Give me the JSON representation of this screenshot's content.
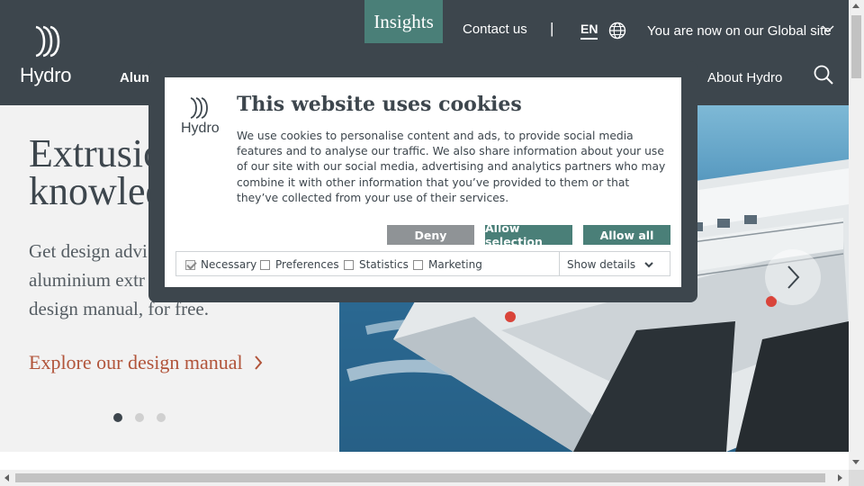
{
  "header": {
    "logo_text": "Hydro",
    "insights": "Insights",
    "contact": "Contact us",
    "separator": "|",
    "language": "EN",
    "site_switch": "You are now on our Global site",
    "nav_aluminium": "Alum",
    "nav_about": "About Hydro"
  },
  "hero": {
    "title": "Extrusio\nknowled",
    "text": "Get design advi\naluminium extr\ndesign manual, for free.",
    "link": "Explore our design manual",
    "slides": 3,
    "active_slide": 1
  },
  "cookie": {
    "logo_text": "Hydro",
    "title": "This website uses cookies",
    "text": "We use cookies to personalise content and ads, to provide social media features and to analyse our traffic. We also share information about your use of our site with our social media, advertising and analytics partners who may combine it with other information that you’ve provided to them or that they’ve collected from your use of their services.",
    "deny": "Deny",
    "allow_selection": "Allow selection",
    "allow_all": "Allow all",
    "options": {
      "necessary": "Necessary",
      "preferences": "Preferences",
      "statistics": "Statistics",
      "marketing": "Marketing"
    },
    "show_details": "Show details"
  },
  "colors": {
    "header_bg": "#3d464d",
    "accent_teal": "#4a7f78",
    "link_rust": "#b1543a",
    "deny_gray": "#8f9396"
  },
  "icons": [
    "hydro-logo-icon",
    "globe-icon",
    "chevron-down-icon",
    "search-icon",
    "chevron-right-icon",
    "checkbox-icon"
  ]
}
